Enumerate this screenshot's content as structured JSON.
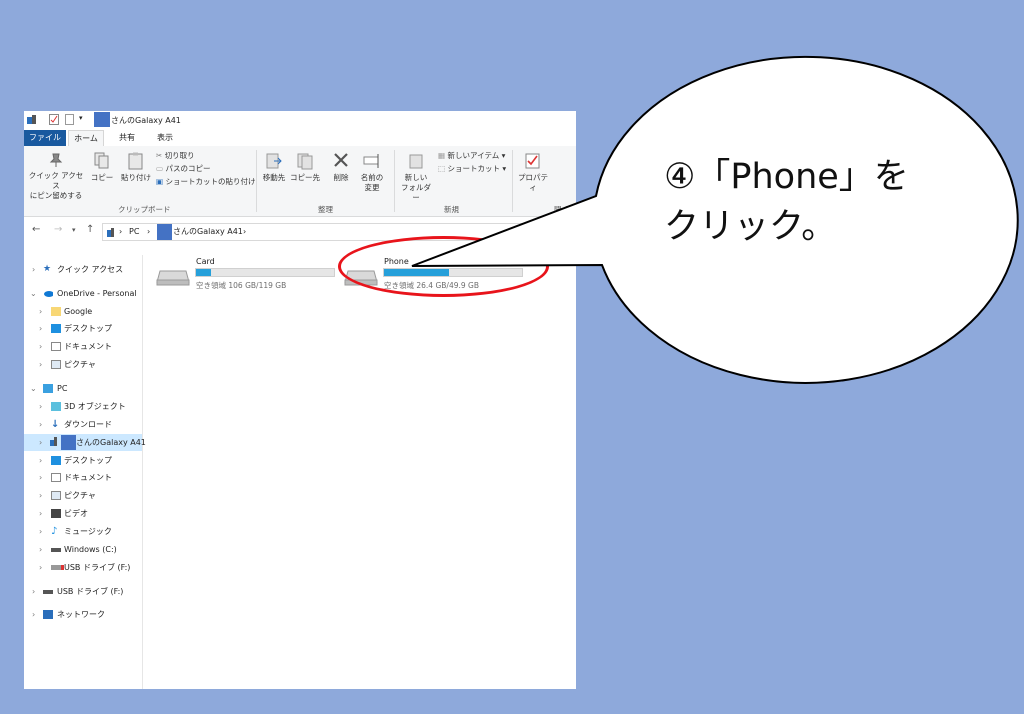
{
  "window": {
    "title": "さんのGalaxy A41",
    "tabs": [
      "ファイル",
      "ホーム",
      "共有",
      "表示"
    ]
  },
  "ribbon": {
    "pin_label_1": "クイック アクセス",
    "pin_label_2": "にピン留めする",
    "copy": "コピー",
    "paste": "貼り付け",
    "cut": "切り取り",
    "copy_path": "パスのコピー",
    "paste_shortcut": "ショートカットの貼り付け",
    "clipboard_group": "クリップボード",
    "move_to": "移動先",
    "copy_to": "コピー先",
    "delete": "削除",
    "rename_1": "名前の",
    "rename_2": "変更",
    "organize_group": "整理",
    "new_folder_1": "新しい",
    "new_folder_2": "フォルダー",
    "new_item": "新しいアイテム ▾",
    "shortcut": "ショートカット ▾",
    "new_group": "新規",
    "properties": "プロパティ",
    "open_group": "開く"
  },
  "address": {
    "pc": "PC",
    "device": "さんのGalaxy A41"
  },
  "nav": {
    "quick_access": "クイック アクセス",
    "onedrive": "OneDrive - Personal",
    "google": "Google",
    "desktop": "デスクトップ",
    "documents": "ドキュメント",
    "pictures": "ピクチャ",
    "pc": "PC",
    "objects3d": "3D オブジェクト",
    "downloads": "ダウンロード",
    "galaxy": "さんのGalaxy A41",
    "desktop2": "デスクトップ",
    "documents2": "ドキュメント",
    "pictures2": "ピクチャ",
    "videos": "ビデオ",
    "music": "ミュージック",
    "windows_c": "Windows (C:)",
    "usb_f": "USB ドライブ (F:)",
    "usb_f2": "USB ドライブ (F:)",
    "network": "ネットワーク"
  },
  "drives": [
    {
      "name": "Card",
      "free": "空き領域 106 GB/119 GB",
      "used_fraction": 0.11
    },
    {
      "name": "Phone",
      "free": "空き領域 26.4 GB/49.9 GB",
      "used_fraction": 0.47
    }
  ],
  "callout": {
    "line1": "④「Phone」を",
    "line2": "クリック。"
  },
  "colors": {
    "background": "#8EA9DB",
    "highlight": "#E8141B",
    "accent": "#26A0DA"
  }
}
